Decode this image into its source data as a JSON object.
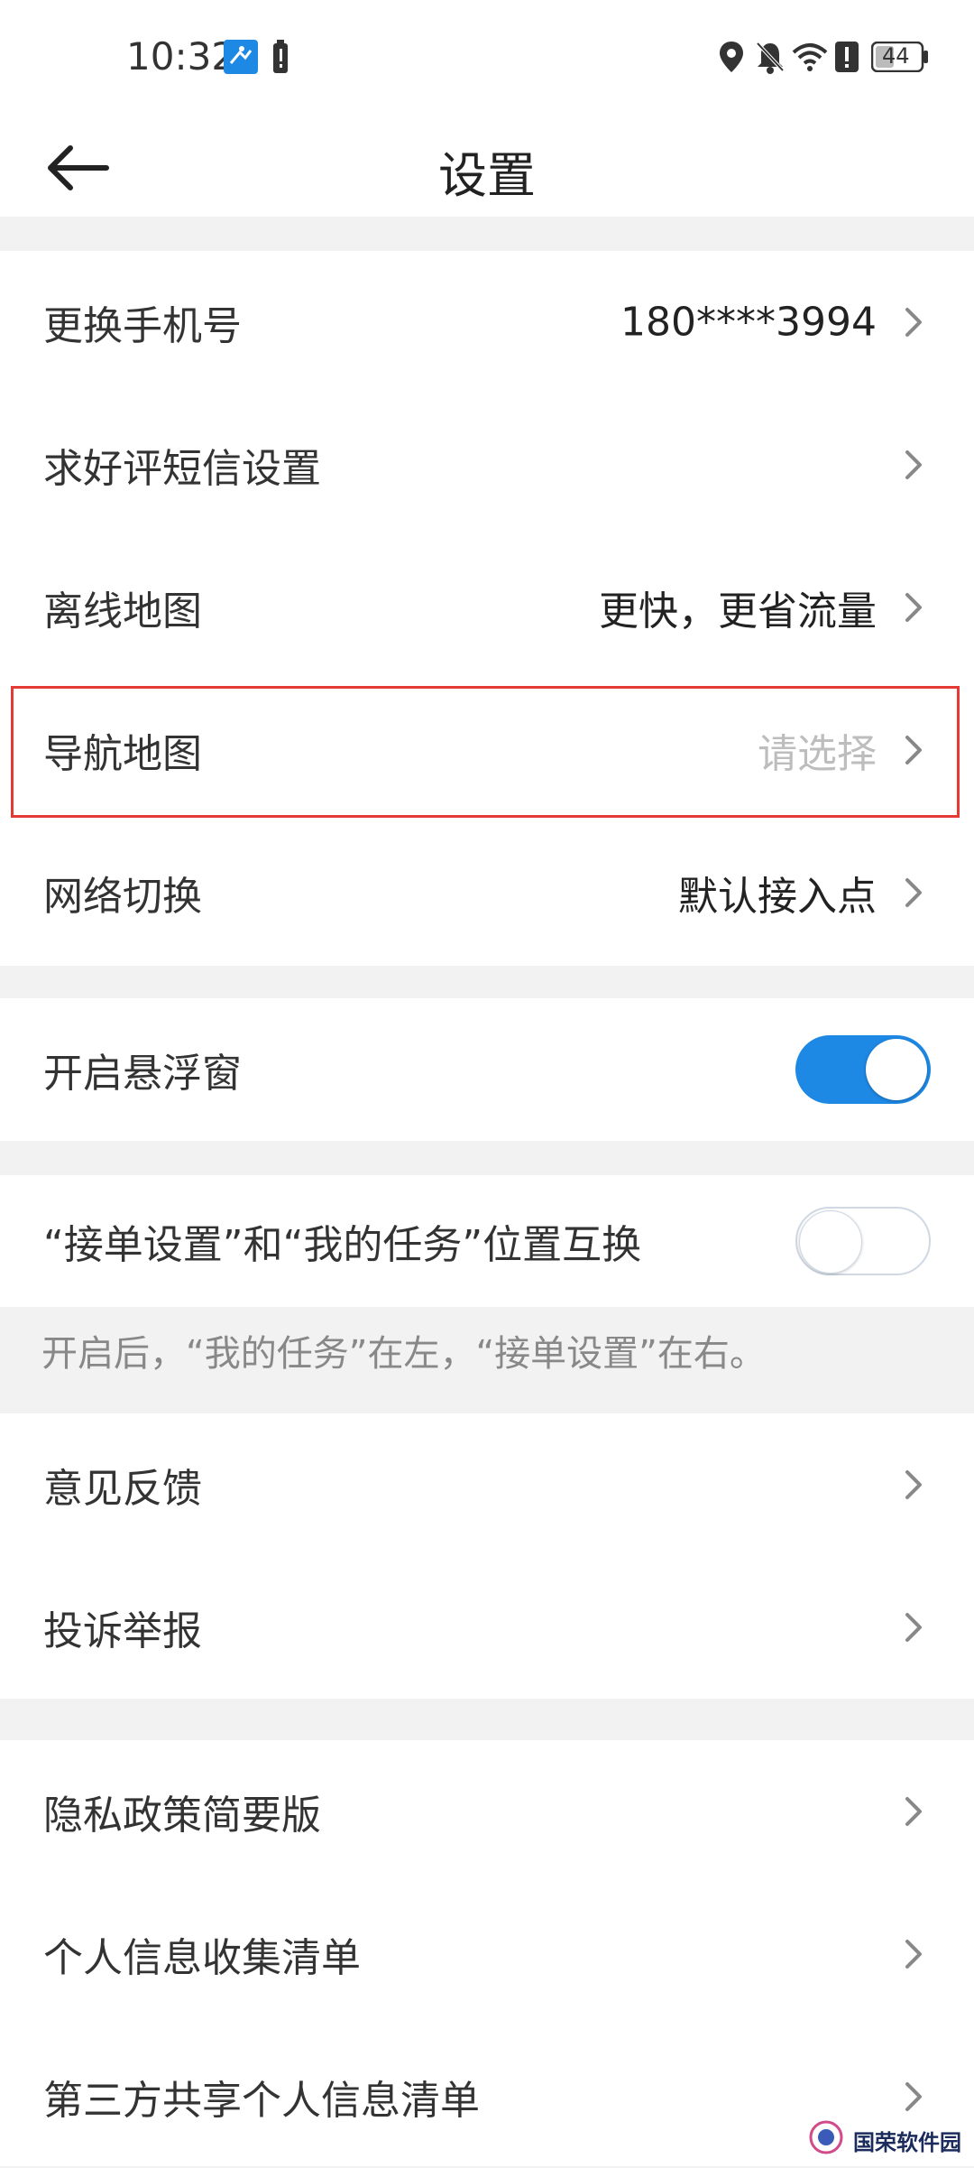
{
  "status_bar": {
    "time": "10:32",
    "battery_level": "44"
  },
  "header": {
    "title": "设置"
  },
  "group1": [
    {
      "label": "更换手机号",
      "value": "180****3994"
    },
    {
      "label": "求好评短信设置",
      "value": ""
    },
    {
      "label": "离线地图",
      "value": "更快，更省流量"
    },
    {
      "label": "导航地图",
      "value": "请选择"
    },
    {
      "label": "网络切换",
      "value": "默认接入点"
    }
  ],
  "floating_window": {
    "label": "开启悬浮窗",
    "enabled": true
  },
  "swap_position": {
    "label": "“接单设置”和“我的任务”位置互换",
    "enabled": false,
    "note": "开启后，“我的任务”在左，“接单设置”在右。"
  },
  "group3": [
    {
      "label": "意见反馈"
    },
    {
      "label": "投诉举报"
    }
  ],
  "group4": [
    {
      "label": "隐私政策简要版"
    },
    {
      "label": "个人信息收集清单"
    },
    {
      "label": "第三方共享个人信息清单"
    }
  ],
  "watermark": {
    "text": "国荣软件园"
  },
  "colors": {
    "accent": "#1e88e5",
    "highlight": "#e53935"
  }
}
